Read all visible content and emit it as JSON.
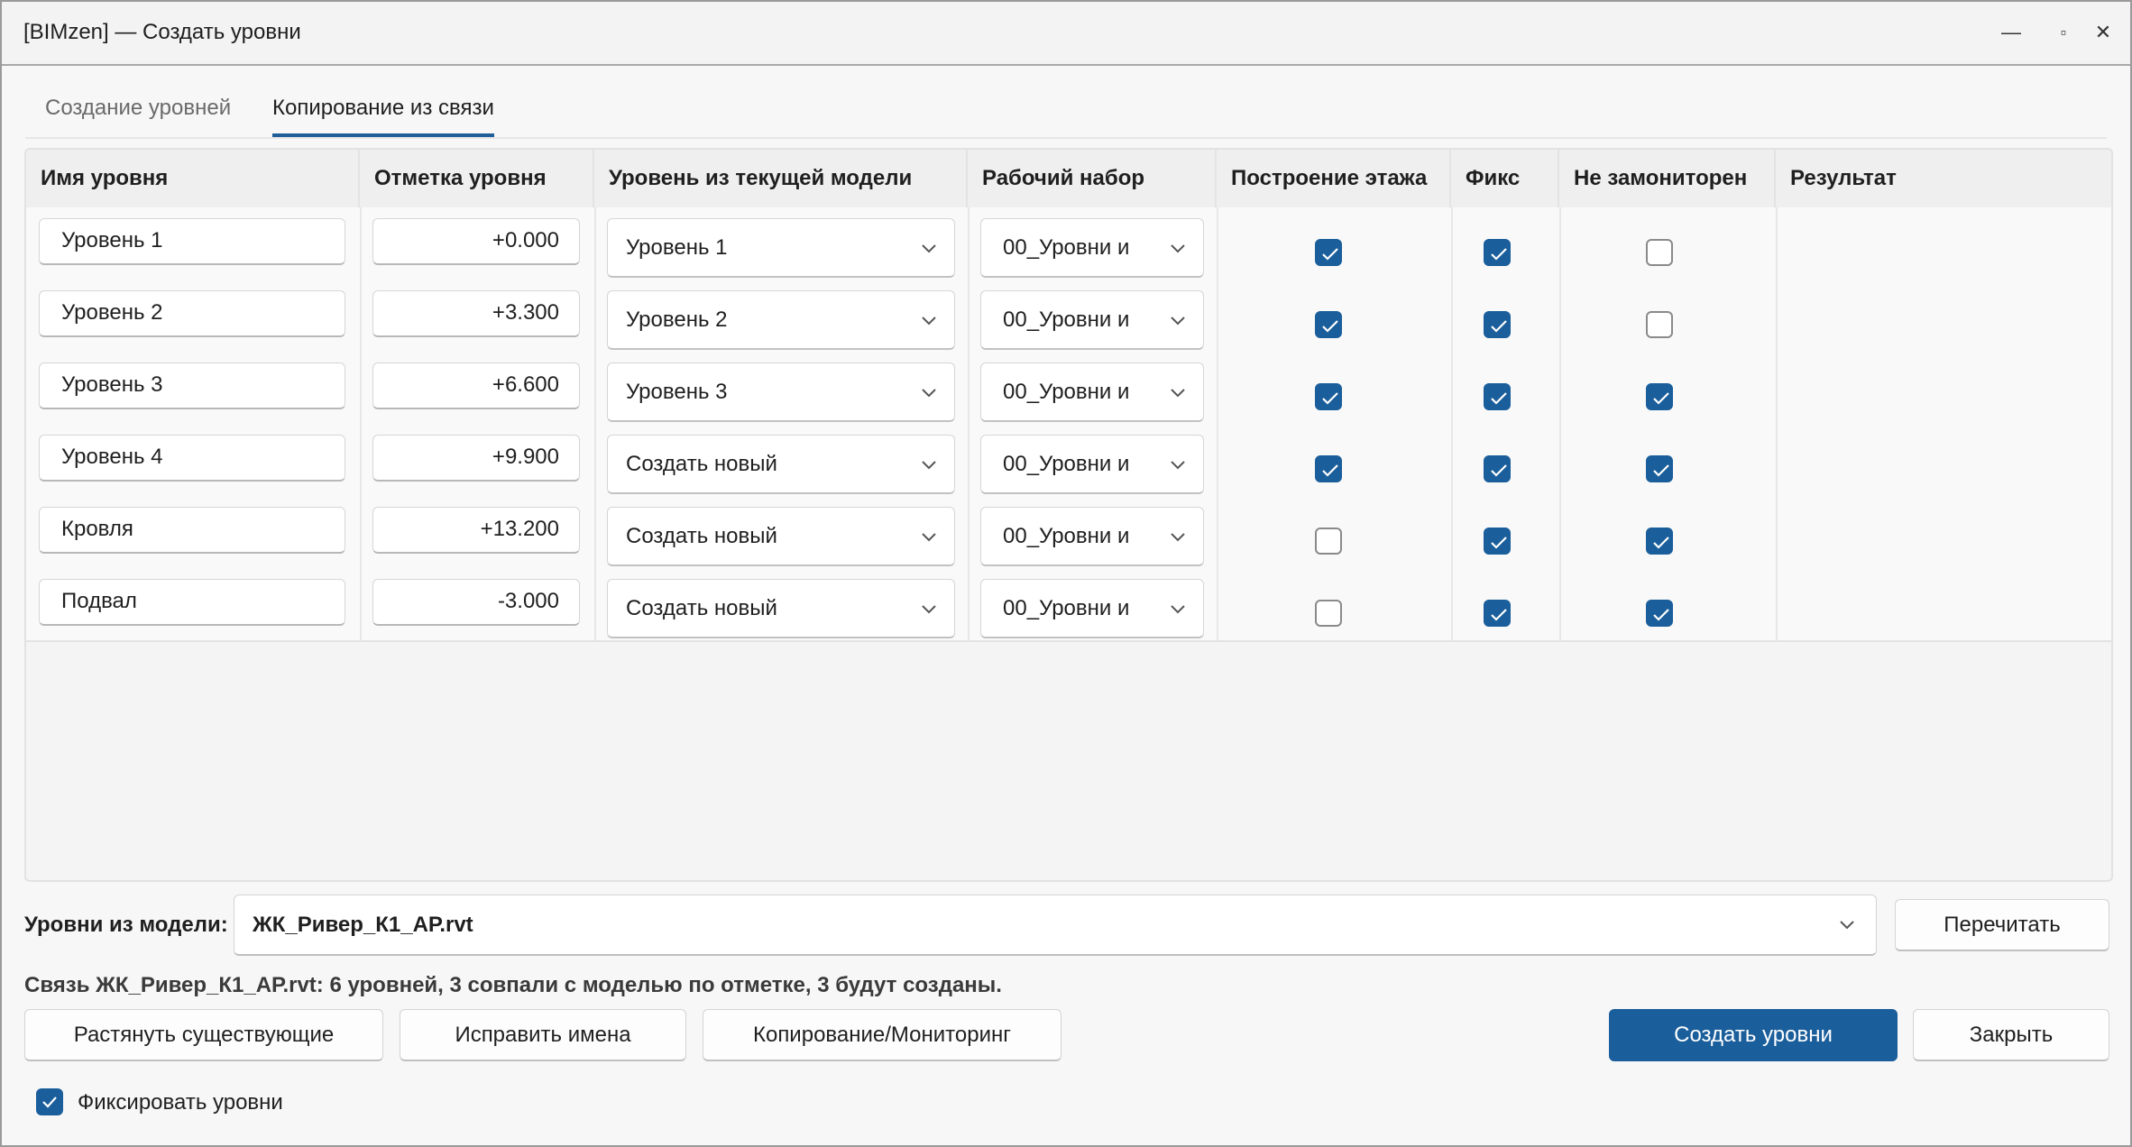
{
  "window": {
    "title": "[BIMzen] — Создать уровни",
    "controls": {
      "minimize": "—",
      "maximize": "▫",
      "close": "✕"
    }
  },
  "tabs": [
    {
      "label": "Создание уровней",
      "active": false
    },
    {
      "label": "Копирование из связи",
      "active": true
    }
  ],
  "grid": {
    "headers": {
      "name": "Имя уровня",
      "elevation": "Отметка уровня",
      "level": "Уровень из текущей модели",
      "workset": "Рабочий набор",
      "floor": "Построение этажа",
      "fix": "Фикс",
      "unmonitored": "Не замониторен",
      "result": "Результат"
    },
    "rows": [
      {
        "name": "Уровень 1",
        "elevation": "+0.000",
        "level": "Уровень 1",
        "workset": "00_Уровни и",
        "floor": true,
        "fix": true,
        "unmonitored": false,
        "result": ""
      },
      {
        "name": "Уровень 2",
        "elevation": "+3.300",
        "level": "Уровень 2",
        "workset": "00_Уровни и",
        "floor": true,
        "fix": true,
        "unmonitored": false,
        "result": ""
      },
      {
        "name": "Уровень 3",
        "elevation": "+6.600",
        "level": "Уровень 3",
        "workset": "00_Уровни и",
        "floor": true,
        "fix": true,
        "unmonitored": true,
        "result": ""
      },
      {
        "name": "Уровень 4",
        "elevation": "+9.900",
        "level": "Создать новый",
        "workset": "00_Уровни и",
        "floor": true,
        "fix": true,
        "unmonitored": true,
        "result": ""
      },
      {
        "name": "Кровля",
        "elevation": "+13.200",
        "level": "Создать новый",
        "workset": "00_Уровни и",
        "floor": false,
        "fix": true,
        "unmonitored": true,
        "result": ""
      },
      {
        "name": "Подвал",
        "elevation": "-3.000",
        "level": "Создать новый",
        "workset": "00_Уровни и",
        "floor": false,
        "fix": true,
        "unmonitored": true,
        "result": ""
      }
    ]
  },
  "source": {
    "label": "Уровни из модели:",
    "model": "ЖК_Ривер_К1_АР.rvt",
    "reread_button": "Перечитать",
    "status": "Связь ЖК_Ривер_К1_АР.rvt: 6 уровней, 3 совпали с моделью по отметке, 3 будут созданы."
  },
  "actions": {
    "stretch": "Растянуть существующие",
    "fix_names": "Исправить имена",
    "copy_monitor": "Копирование/Мониторинг",
    "create": "Создать уровни",
    "close": "Закрыть"
  },
  "options": {
    "fix_levels_label": "Фиксировать уровни",
    "fix_levels_checked": true
  },
  "colors": {
    "accent": "#1a5e9b"
  }
}
